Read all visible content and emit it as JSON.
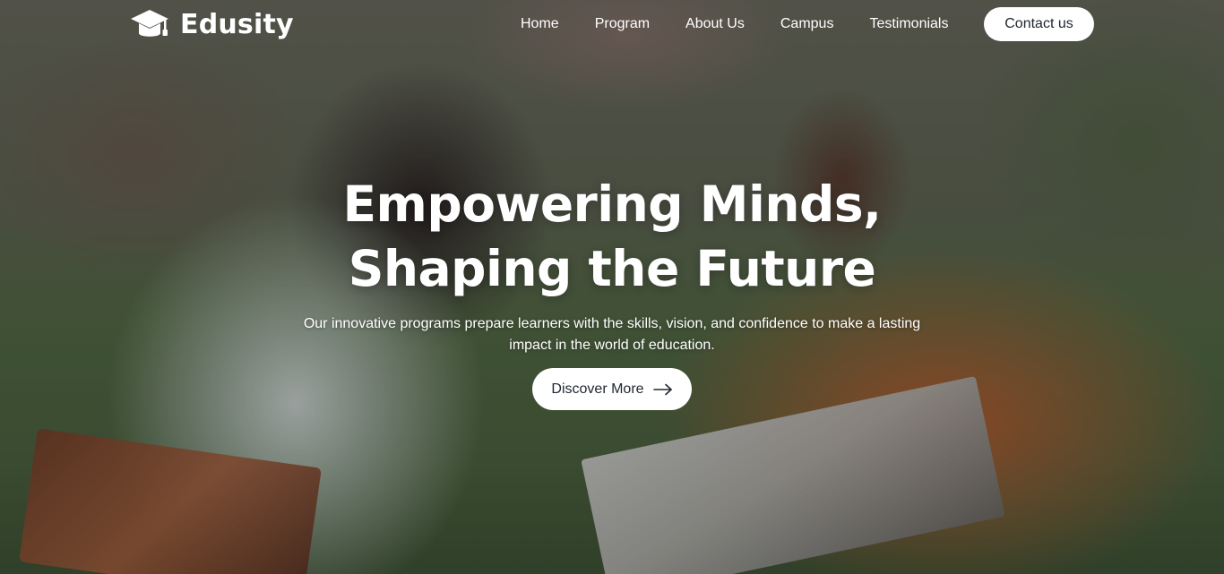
{
  "brand": {
    "name": "Edusity",
    "logo_icon": "graduation-cap-icon"
  },
  "nav": {
    "items": [
      {
        "label": "Home"
      },
      {
        "label": "Program"
      },
      {
        "label": "About Us"
      },
      {
        "label": "Campus"
      },
      {
        "label": "Testimonials"
      }
    ],
    "contact_label": "Contact us"
  },
  "hero": {
    "headline": "Empowering Minds, Shaping the Future",
    "subtext": "Our innovative programs prepare learners with the skills, vision, and confidence to make a lasting impact in the world of education.",
    "cta_label": "Discover More",
    "cta_icon": "arrow-right-icon"
  },
  "colors": {
    "button_bg": "#ffffff",
    "button_text": "#212832",
    "text": "#ffffff"
  }
}
